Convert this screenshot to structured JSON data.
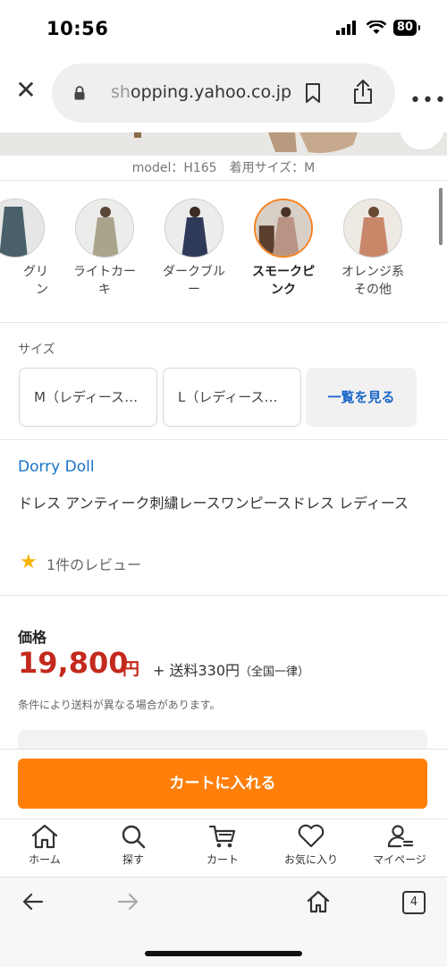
{
  "status": {
    "time": "10:56",
    "battery": "80"
  },
  "browser": {
    "url_host_prefix": "sh",
    "url_host_rest": "opping.yahoo.co.jp",
    "tab_count": "4"
  },
  "product": {
    "model_caption": "model：H165　着用サイズ：M",
    "brand": "Dorry Doll",
    "title": "ドレス アンティーク刺繍レースワンピースドレス レディース",
    "review": "1件のレビュー"
  },
  "colors": [
    {
      "label": "グリ\nン",
      "selected": false,
      "tone": "#49606a"
    },
    {
      "label": "ライトカー\nキ",
      "selected": false,
      "tone": "#a9a48c"
    },
    {
      "label": "ダークブル\nー",
      "selected": false,
      "tone": "#2f3a5b"
    },
    {
      "label": "スモークピ\nンク",
      "selected": true,
      "tone": "#b99484"
    },
    {
      "label": "オレンジ系\nその他",
      "selected": false,
      "tone": "#c9876a"
    }
  ],
  "size": {
    "title": "サイズ",
    "options": [
      "M（レディース…",
      "L（レディース…"
    ],
    "more_label": "一覧を見る"
  },
  "price": {
    "label": "価格",
    "amount": "19,800",
    "yen": "円",
    "shipping": "+ 送料330円",
    "shipping_note": "（全国一律）",
    "condition": "条件により送料が異なる場合があります。"
  },
  "cart_button": "カートに入れる",
  "nav": [
    {
      "label": "ホーム",
      "icon": "home-icon"
    },
    {
      "label": "探す",
      "icon": "search-icon"
    },
    {
      "label": "カート",
      "icon": "cart-icon"
    },
    {
      "label": "お気に入り",
      "icon": "heart-icon"
    },
    {
      "label": "マイページ",
      "icon": "user-icon"
    }
  ],
  "accent": {
    "orange": "#ff7f0a",
    "price_red": "#c4291d",
    "link_blue": "#1a73c8"
  }
}
